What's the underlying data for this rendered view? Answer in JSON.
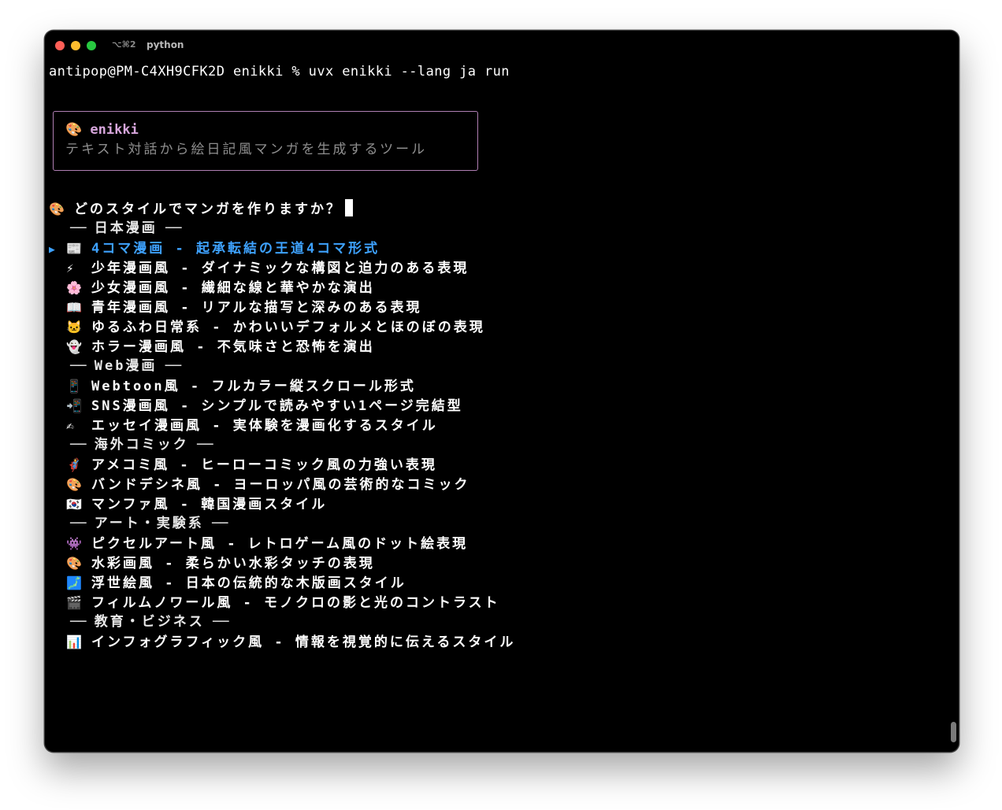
{
  "window": {
    "tab_shortcut": "⌥⌘2",
    "tab_title": "python"
  },
  "terminal": {
    "prompt_line": "antipop@PM-C4XH9CFK2D enikki % uvx enikki --lang ja run",
    "banner": {
      "icon": "🎨",
      "title": "enikki",
      "subtitle": "テキスト対話から絵日記風マンガを生成するツール"
    },
    "question": {
      "icon": "🎨",
      "text": "どのスタイルでマンガを作りますか？"
    },
    "selected_pointer": "▶",
    "menu": [
      {
        "kind": "group",
        "label": "日本漫画"
      },
      {
        "kind": "option",
        "icon": "📰",
        "label": "4コマ漫画 - 起承転結の王道4コマ形式",
        "selected": true
      },
      {
        "kind": "option",
        "icon": "⚡",
        "label": "少年漫画風 - ダイナミックな構図と迫力のある表現"
      },
      {
        "kind": "option",
        "icon": "🌸",
        "label": "少女漫画風 - 繊細な線と華やかな演出"
      },
      {
        "kind": "option",
        "icon": "📖",
        "label": "青年漫画風 - リアルな描写と深みのある表現"
      },
      {
        "kind": "option",
        "icon": "🐱",
        "label": "ゆるふわ日常系 - かわいいデフォルメとほのぼの表現"
      },
      {
        "kind": "option",
        "icon": "👻",
        "label": "ホラー漫画風 - 不気味さと恐怖を演出"
      },
      {
        "kind": "group",
        "label": "Web漫画"
      },
      {
        "kind": "option",
        "icon": "📱",
        "label": "Webtoon風 - フルカラー縦スクロール形式"
      },
      {
        "kind": "option",
        "icon": "📲",
        "label": "SNS漫画風 - シンプルで読みやすい1ページ完結型"
      },
      {
        "kind": "option",
        "icon": "✍",
        "label": "エッセイ漫画風 - 実体験を漫画化するスタイル"
      },
      {
        "kind": "group",
        "label": "海外コミック"
      },
      {
        "kind": "option",
        "icon": "🦸",
        "label": "アメコミ風 - ヒーローコミック風の力強い表現"
      },
      {
        "kind": "option",
        "icon": "🎨",
        "label": "バンドデシネ風 - ヨーロッパ風の芸術的なコミック"
      },
      {
        "kind": "option",
        "icon": "🇰🇷",
        "label": "マンファ風 - 韓国漫画スタイル"
      },
      {
        "kind": "group",
        "label": "アート・実験系"
      },
      {
        "kind": "option",
        "icon": "👾",
        "label": "ピクセルアート風 - レトロゲーム風のドット絵表現"
      },
      {
        "kind": "option",
        "icon": "🎨",
        "label": "水彩画風 - 柔らかい水彩タッチの表現"
      },
      {
        "kind": "option",
        "icon": "🗾",
        "label": "浮世絵風 - 日本の伝統的な木版画スタイル"
      },
      {
        "kind": "option",
        "icon": "🎬",
        "label": "フィルムノワール風 - モノクロの影と光のコントラスト"
      },
      {
        "kind": "group",
        "label": "教育・ビジネス"
      },
      {
        "kind": "option",
        "icon": "📊",
        "label": "インフォグラフィック風 - 情報を視覚的に伝えるスタイル"
      }
    ],
    "colors": {
      "background": "#000000",
      "selected": "#3ea2ff",
      "banner_border": "#b07fb4",
      "banner_title": "#d7a6dc",
      "muted": "#8e8e8e"
    }
  }
}
